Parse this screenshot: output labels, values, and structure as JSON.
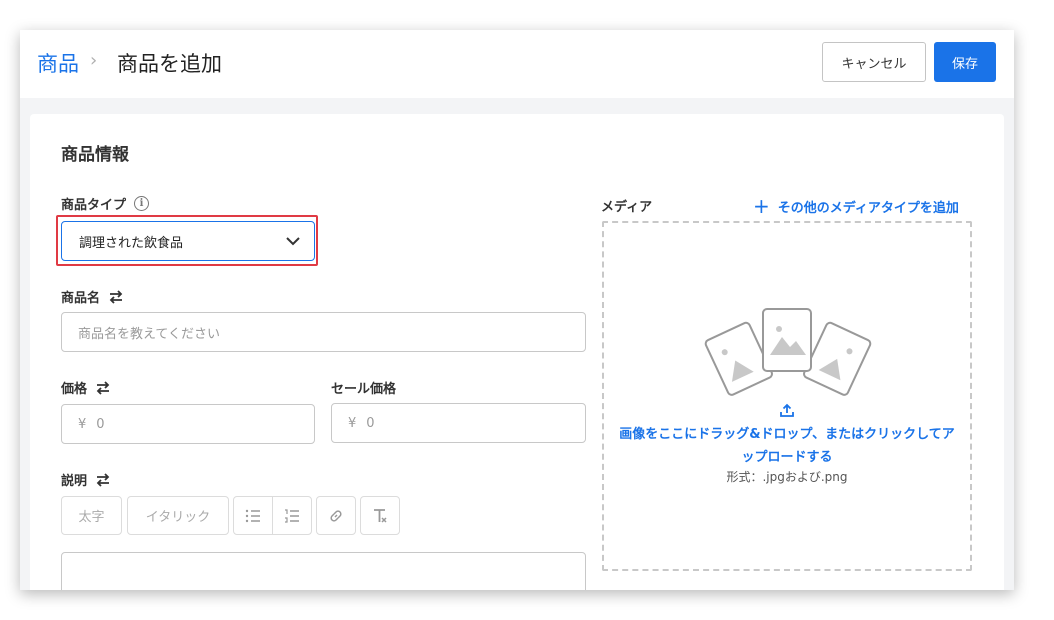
{
  "header": {
    "breadcrumb_root": "商品",
    "breadcrumb_sep": "›",
    "breadcrumb_current": "商品を追加",
    "cancel_label": "キャンセル",
    "save_label": "保存"
  },
  "form": {
    "section_title": "商品情報",
    "product_type": {
      "label": "商品タイプ",
      "value": "調理された飲食品"
    },
    "product_name": {
      "label": "商品名",
      "placeholder": "商品名を教えてください"
    },
    "price": {
      "label": "価格",
      "currency": "¥",
      "value": "0"
    },
    "sale_price": {
      "label": "セール価格",
      "currency": "¥",
      "value": "0"
    },
    "description": {
      "label": "説明",
      "toolbar": {
        "bold": "太字",
        "italic": "イタリック"
      }
    }
  },
  "media": {
    "label": "メディア",
    "add_label": "その他のメディアタイプを追加",
    "drop_text_line1": "画像をここにドラッグ&ドロップ、またはクリックしてア",
    "drop_text_line2": "ップロードする",
    "format_text": "形式：.jpgおよび.png"
  },
  "colors": {
    "accent": "#1a73e8",
    "highlight": "#e03a44"
  }
}
